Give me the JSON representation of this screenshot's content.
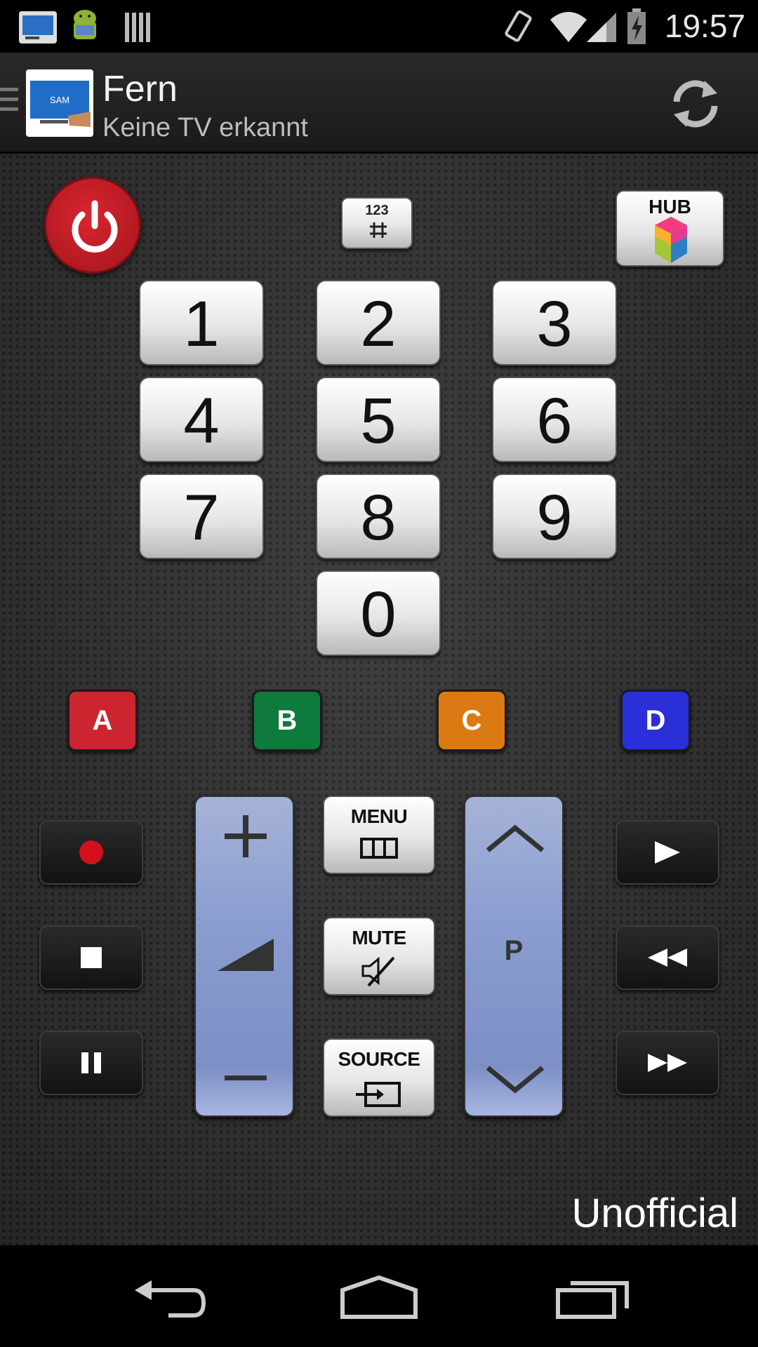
{
  "status_bar": {
    "time": "19:57",
    "notification_icons": [
      "tv-remote-app-icon",
      "android-debug-icon",
      "barcode-icon"
    ],
    "system_icons": [
      "vibrate-icon",
      "wifi-icon",
      "signal-icon",
      "battery-charging-icon"
    ]
  },
  "action_bar": {
    "title": "Fern",
    "subtitle": "Keine TV erkannt",
    "app_icon_text": "SAM",
    "refresh_icon": "refresh-icon"
  },
  "remote": {
    "top_row": {
      "power_icon": "power-icon",
      "numpad_toggle_label": "123",
      "hub_label": "HUB"
    },
    "number_keys": [
      "1",
      "2",
      "3",
      "4",
      "5",
      "6",
      "7",
      "8",
      "9",
      "0"
    ],
    "color_keys": [
      {
        "label": "A",
        "color": "#cc2530"
      },
      {
        "label": "B",
        "color": "#0e7a3c"
      },
      {
        "label": "C",
        "color": "#db7a12"
      },
      {
        "label": "D",
        "color": "#2a2fd8"
      }
    ],
    "left_column": [
      "record-icon",
      "stop-icon",
      "pause-icon"
    ],
    "right_column": [
      "play-icon",
      "rewind-icon",
      "fast-forward-icon"
    ],
    "volume": {
      "up": "+",
      "down": "−"
    },
    "channel": {
      "label": "P"
    },
    "center_buttons": {
      "menu": "MENU",
      "mute": "MUTE",
      "source": "SOURCE"
    },
    "footer_text": "Unofficial"
  },
  "nav_bar": [
    "back-icon",
    "home-icon",
    "recents-icon"
  ]
}
